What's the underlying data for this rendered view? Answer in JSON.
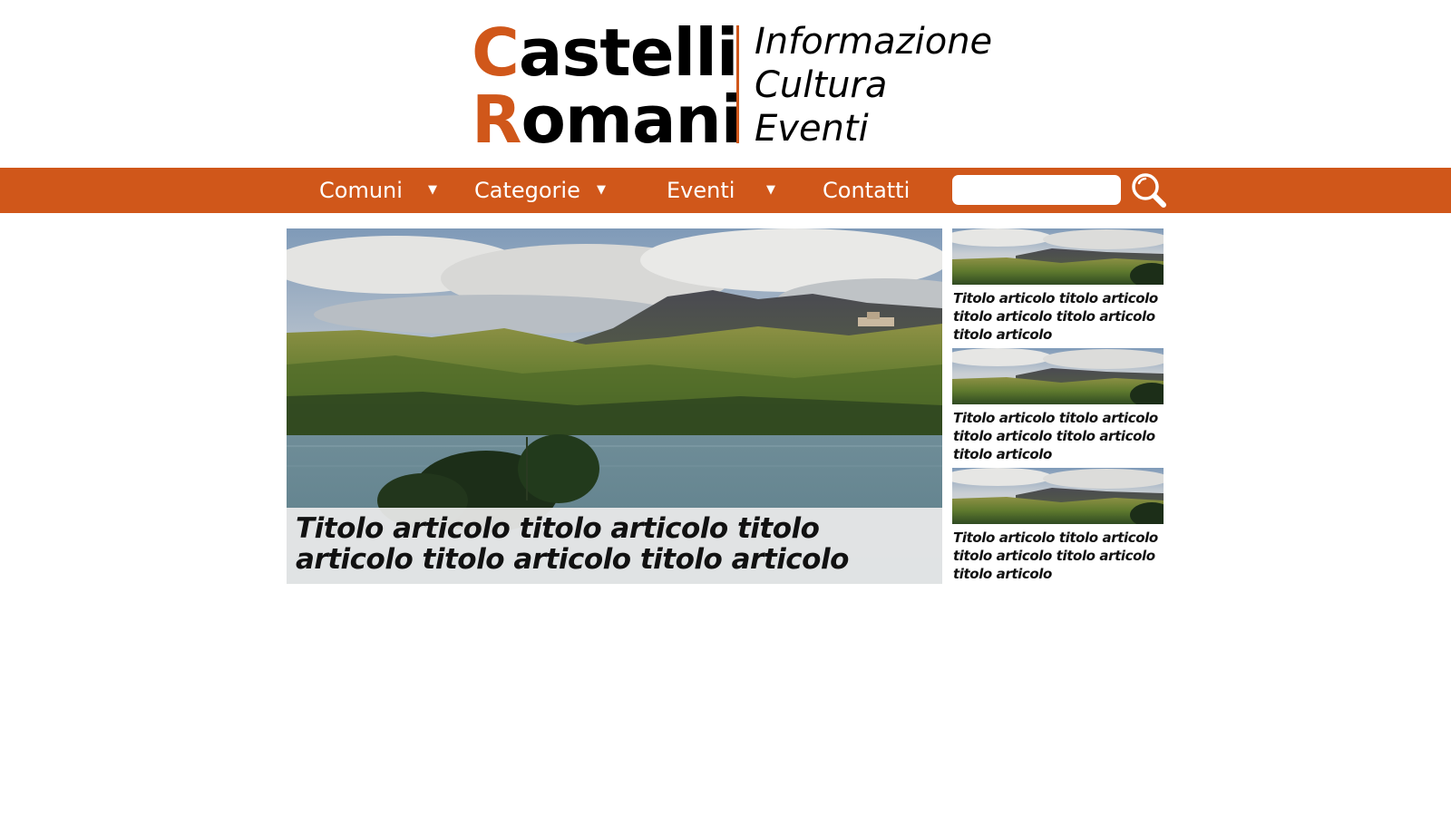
{
  "brand": {
    "line1_initial": "C",
    "line1_rest": "astelli",
    "line2_initial": "R",
    "line2_rest": "omani",
    "tagline": [
      "Informazione",
      "Cultura",
      "Eventi"
    ],
    "accent_color": "#d0571a"
  },
  "nav": {
    "items": [
      {
        "label": "Comuni",
        "has_dropdown": true
      },
      {
        "label": "Categorie",
        "has_dropdown": true
      },
      {
        "label": "Eventi",
        "has_dropdown": true
      },
      {
        "label": "Contatti",
        "has_dropdown": false
      }
    ],
    "caret": "▼",
    "search": {
      "value": "",
      "icon": "search-icon"
    }
  },
  "featured": {
    "title": "Titolo articolo titolo articolo titolo articolo titolo articolo titolo articolo",
    "image": "lake-landscape"
  },
  "side_articles": [
    {
      "title": "Titolo articolo titolo articolo titolo articolo titolo articolo titolo articolo",
      "image": "lake-landscape-thumb"
    },
    {
      "title": "Titolo articolo titolo articolo titolo articolo titolo articolo titolo articolo",
      "image": "lake-landscape-thumb"
    },
    {
      "title": "Titolo articolo titolo articolo titolo articolo titolo articolo titolo articolo",
      "image": "lake-landscape-thumb"
    }
  ]
}
